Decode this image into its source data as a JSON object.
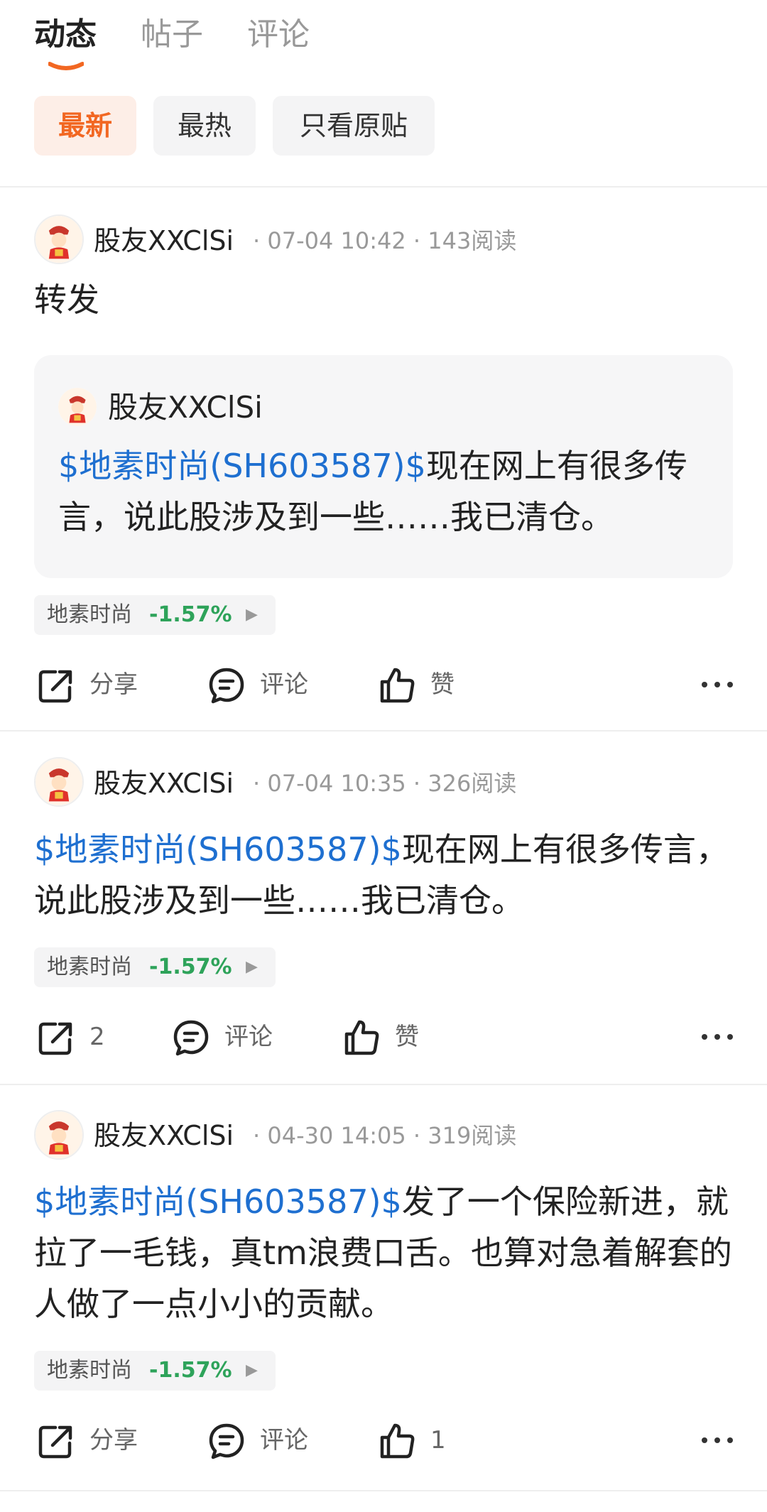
{
  "tabs": [
    {
      "label": "动态",
      "active": true
    },
    {
      "label": "帖子",
      "active": false
    },
    {
      "label": "评论",
      "active": false
    }
  ],
  "filters": [
    {
      "label": "最新",
      "active": true
    },
    {
      "label": "最热",
      "active": false
    },
    {
      "label": "只看原贴",
      "active": false
    }
  ],
  "colors": {
    "accent": "#f26722",
    "link": "#1e6fd0",
    "down": "#2ea35a"
  },
  "posts": [
    {
      "user": "股友XXClSi",
      "time": "07-04 10:42",
      "reads": "143阅读",
      "text": "转发",
      "quote": {
        "user": "股友XXClSi",
        "link": "$地素时尚(SH603587)$",
        "text": "现在网上有很多传言，说此股涉及到一些……我已清仓。"
      },
      "stock": {
        "name": "地素时尚",
        "change": "-1.57%"
      },
      "actions": {
        "share": "分享",
        "comment": "评论",
        "like": "赞"
      }
    },
    {
      "user": "股友XXClSi",
      "time": "07-04 10:35",
      "reads": "326阅读",
      "link": "$地素时尚(SH603587)$",
      "text": "现在网上有很多传言，说此股涉及到一些……我已清仓。",
      "stock": {
        "name": "地素时尚",
        "change": "-1.57%"
      },
      "actions": {
        "share": "2",
        "comment": "评论",
        "like": "赞"
      }
    },
    {
      "user": "股友XXClSi",
      "time": "04-30 14:05",
      "reads": "319阅读",
      "link": "$地素时尚(SH603587)$",
      "text": "发了一个保险新进，就拉了一毛钱，真tm浪费口舌。也算对急着解套的人做了一点小小的贡献。",
      "stock": {
        "name": "地素时尚",
        "change": "-1.57%"
      },
      "actions": {
        "share": "分享",
        "comment": "评论",
        "like": "1"
      }
    }
  ]
}
